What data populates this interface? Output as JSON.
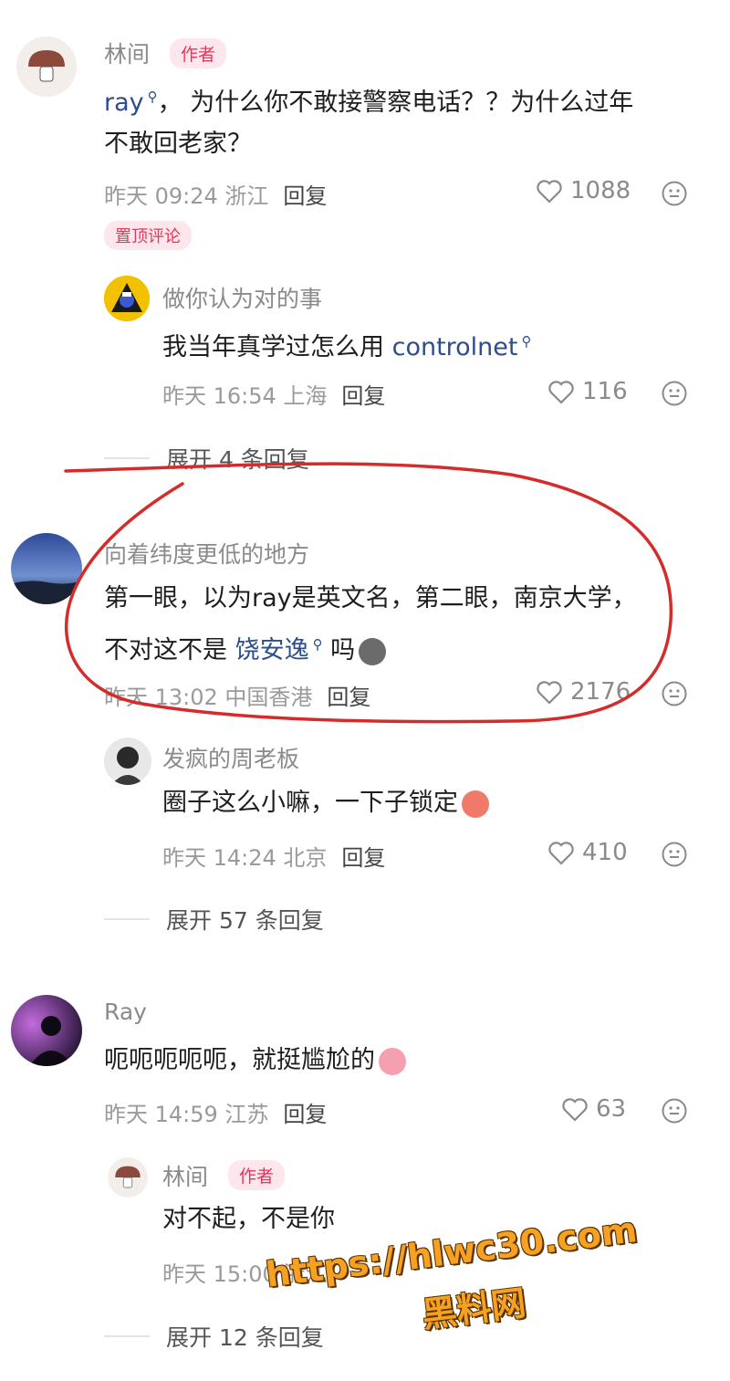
{
  "comments": [
    {
      "author": "林间",
      "tag": "作者",
      "mention": "ray",
      "text_line1_rest": "， 为什么你不敢接警察电话？？为什么过年",
      "text_line2": "不敢回老家？",
      "time": "昨天 09:24 浙江",
      "reply_label": "回复",
      "likes": "1088",
      "pinned_label": "置顶评论",
      "replies": [
        {
          "author": "做你认为对的事",
          "text_prefix": "我当年真学过怎么用 ",
          "mention": "controlnet",
          "time": "昨天 16:54 上海",
          "reply_label": "回复",
          "likes": "116"
        }
      ],
      "expand_label": "展开 4 条回复"
    },
    {
      "author": "向着纬度更低的地方",
      "text_line1": "第一眼，以为ray是英文名，第二眼，南京大学，",
      "text_line2_prefix": "不对这不是 ",
      "mention": "饶安逸",
      "text_line2_suffix": " 吗",
      "time": "昨天 13:02 中国香港",
      "reply_label": "回复",
      "likes": "2176",
      "replies": [
        {
          "author": "发疯的周老板",
          "text": "圈子这么小嘛，一下子锁定",
          "time": "昨天 14:24 北京",
          "reply_label": "回复",
          "likes": "410"
        }
      ],
      "expand_label": "展开 57 条回复"
    },
    {
      "author": "Ray",
      "text": "呃呃呃呃呃，就挺尴尬的",
      "time": "昨天 14:59 江苏",
      "reply_label": "回复",
      "likes": "63",
      "replies": [
        {
          "author": "林间",
          "tag": "作者",
          "text": "对不起，不是你",
          "time": "昨天 15:00 浙江"
        }
      ],
      "expand_label": "展开 12 条回复"
    }
  ],
  "watermark": {
    "url": "https://hlwc30.com",
    "site": "黑料网"
  },
  "annotation_color": "#d42b2b",
  "mention_icon": "search-magnifier-icon",
  "like_icon": "heart-outline-icon",
  "react_icon": "smiley-face-icon"
}
